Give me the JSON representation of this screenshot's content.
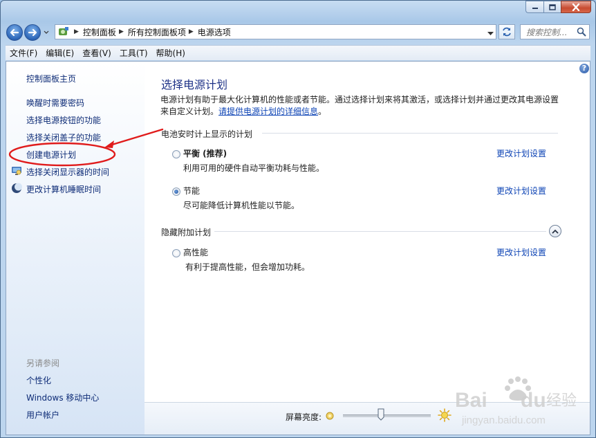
{
  "window": {
    "caption_buttons": [
      "minimize-icon",
      "maximize-icon",
      "close-icon"
    ]
  },
  "address": {
    "crumbs": [
      "控制面板",
      "所有控制面板项",
      "电源选项"
    ],
    "search_placeholder": "搜索控制..."
  },
  "menu": [
    "文件(F)",
    "编辑(E)",
    "查看(V)",
    "工具(T)",
    "帮助(H)"
  ],
  "sidebar": {
    "home": "控制面板主页",
    "links": [
      "唤醒时需要密码",
      "选择电源按钮的功能",
      "选择关闭盖子的功能",
      "创建电源计划",
      "选择关闭显示器的时间",
      "更改计算机睡眠时间"
    ],
    "see_also_title": "另请参阅",
    "see_also": [
      "个性化",
      "Windows 移动中心",
      "用户帐户"
    ]
  },
  "main": {
    "title": "选择电源计划",
    "intro_line1": "电源计划有助于最大化计算机的性能或者节能。通过选择计划来将其激活，或选择计划并通过更改其电源设置",
    "intro_line2_prefix": "来自定义计划。",
    "intro_link": "请提供电源计划的详细信息",
    "intro_line2_suffix": "。",
    "group_shown": "电池安时计上显示的计划",
    "group_hidden": "隐藏附加计划",
    "plans": [
      {
        "name": "平衡 (推荐)",
        "desc": "利用可用的硬件自动平衡功耗与性能。",
        "selected": false,
        "change": "更改计划设置"
      },
      {
        "name": "节能",
        "desc": "尽可能降低计算机性能以节能。",
        "selected": true,
        "change": "更改计划设置"
      },
      {
        "name": "高性能",
        "desc": "有利于提高性能，但会增加功耗。",
        "selected": false,
        "change": "更改计划设置"
      }
    ]
  },
  "brightness": {
    "label": "屏幕亮度:",
    "level": 0.43
  },
  "watermark": {
    "brand": "Baidu经验",
    "url": "jingyan.baidu.com"
  },
  "colors": {
    "link": "#0e44b5",
    "title": "#1e3287",
    "annotation": "#e01b1b"
  }
}
